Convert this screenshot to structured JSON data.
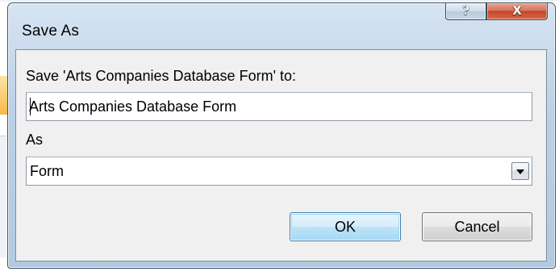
{
  "dialog": {
    "title": "Save As",
    "help_glyph": "?",
    "close_glyph": "X",
    "save_to_label": "Save 'Arts Companies Database Form' to:",
    "name_value": "Arts Companies Database Form",
    "as_label": "As",
    "as_value": "Form",
    "ok_label": "OK",
    "cancel_label": "Cancel"
  },
  "icons": {
    "help": "question-mark-icon",
    "close": "close-x-icon",
    "dropdown": "chevron-down-icon"
  },
  "colors": {
    "frame": "#bcd1e7",
    "close_button": "#c5452a",
    "default_button": "#bde2f6"
  }
}
